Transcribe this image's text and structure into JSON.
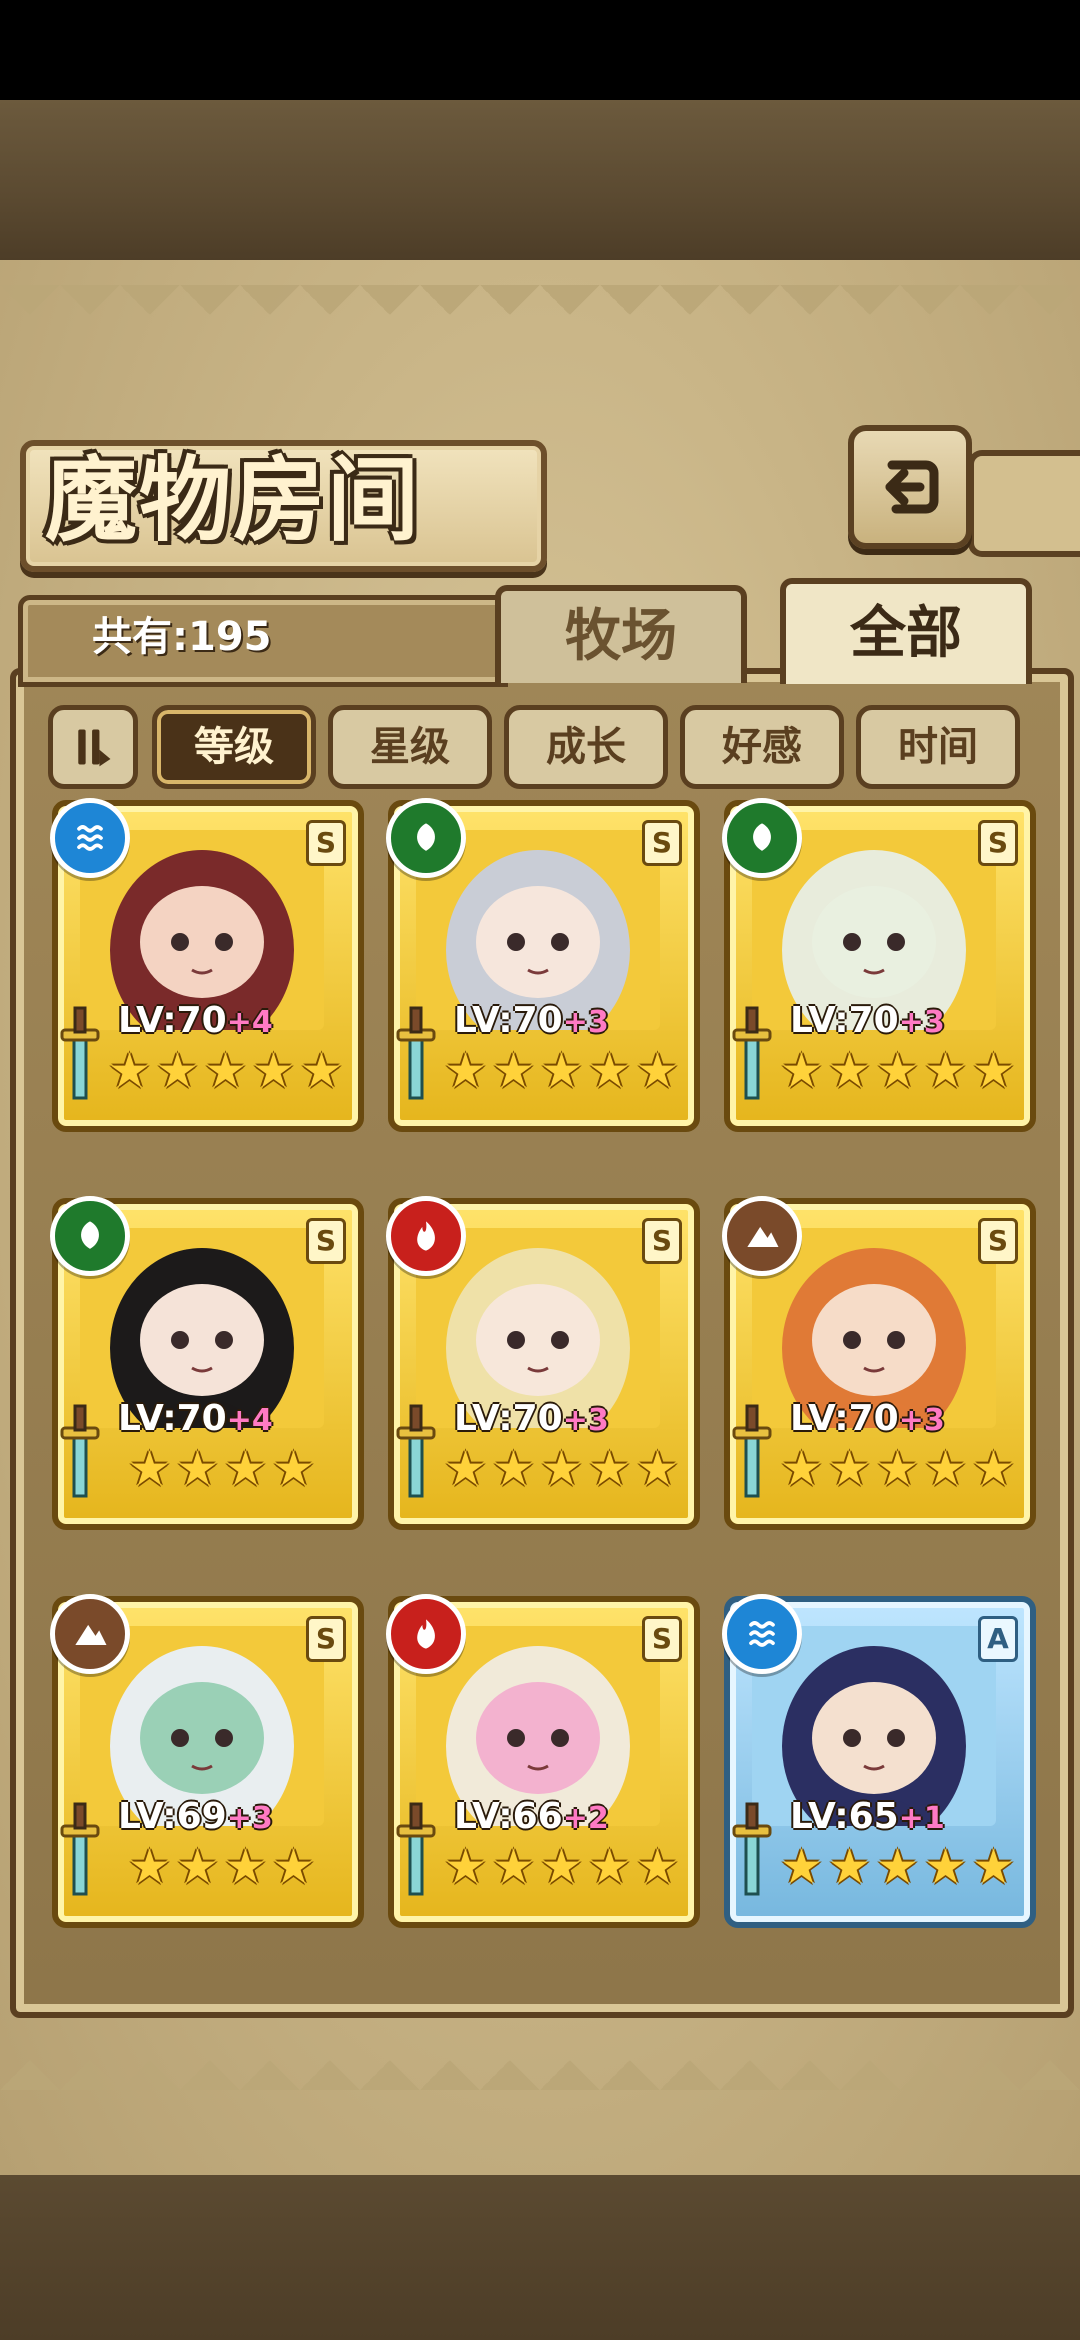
{
  "header": {
    "title": "魔物房间"
  },
  "summary": {
    "count_label": "共有:195"
  },
  "tabs": [
    {
      "label": "牧场",
      "active": false
    },
    {
      "label": "全部",
      "active": true
    }
  ],
  "filters": [
    {
      "label": "等级",
      "active": true
    },
    {
      "label": "星级",
      "active": false
    },
    {
      "label": "成长",
      "active": false
    },
    {
      "label": "好感",
      "active": false
    },
    {
      "label": "时间",
      "active": false
    }
  ],
  "cards": [
    {
      "element": "water",
      "rank": "S",
      "level": "LV:70",
      "plus": "+4",
      "stars": 5,
      "portrait": "red-twin-tails-girl"
    },
    {
      "element": "wind",
      "rank": "S",
      "level": "LV:70",
      "plus": "+3",
      "stars": 5,
      "portrait": "silver-hair-harp-girl"
    },
    {
      "element": "wind",
      "rank": "S",
      "level": "LV:70",
      "plus": "+3",
      "stars": 5,
      "portrait": "white-hair-hat-girl"
    },
    {
      "element": "wind",
      "rank": "S",
      "level": "LV:70",
      "plus": "+4",
      "stars": 4,
      "portrait": "black-hair-bow-girl"
    },
    {
      "element": "fire",
      "rank": "S",
      "level": "LV:70",
      "plus": "+3",
      "stars": 5,
      "portrait": "blonde-cap-girl"
    },
    {
      "element": "earth",
      "rank": "S",
      "level": "LV:70",
      "plus": "+3",
      "stars": 5,
      "portrait": "orange-hood-girl"
    },
    {
      "element": "earth",
      "rank": "S",
      "level": "LV:69",
      "plus": "+3",
      "stars": 4,
      "portrait": "green-skin-horned-girl"
    },
    {
      "element": "fire",
      "rank": "S",
      "level": "LV:66",
      "plus": "+2",
      "stars": 5,
      "portrait": "white-dog-pink-dress"
    },
    {
      "element": "water",
      "rank": "A",
      "level": "LV:65",
      "plus": "+1",
      "stars": 5,
      "portrait": "blue-hair-witch-girl"
    }
  ],
  "colors": {
    "water": "#1e86d6",
    "wind": "#1f7a2c",
    "fire": "#c8201c",
    "earth": "#7a4a2a"
  }
}
